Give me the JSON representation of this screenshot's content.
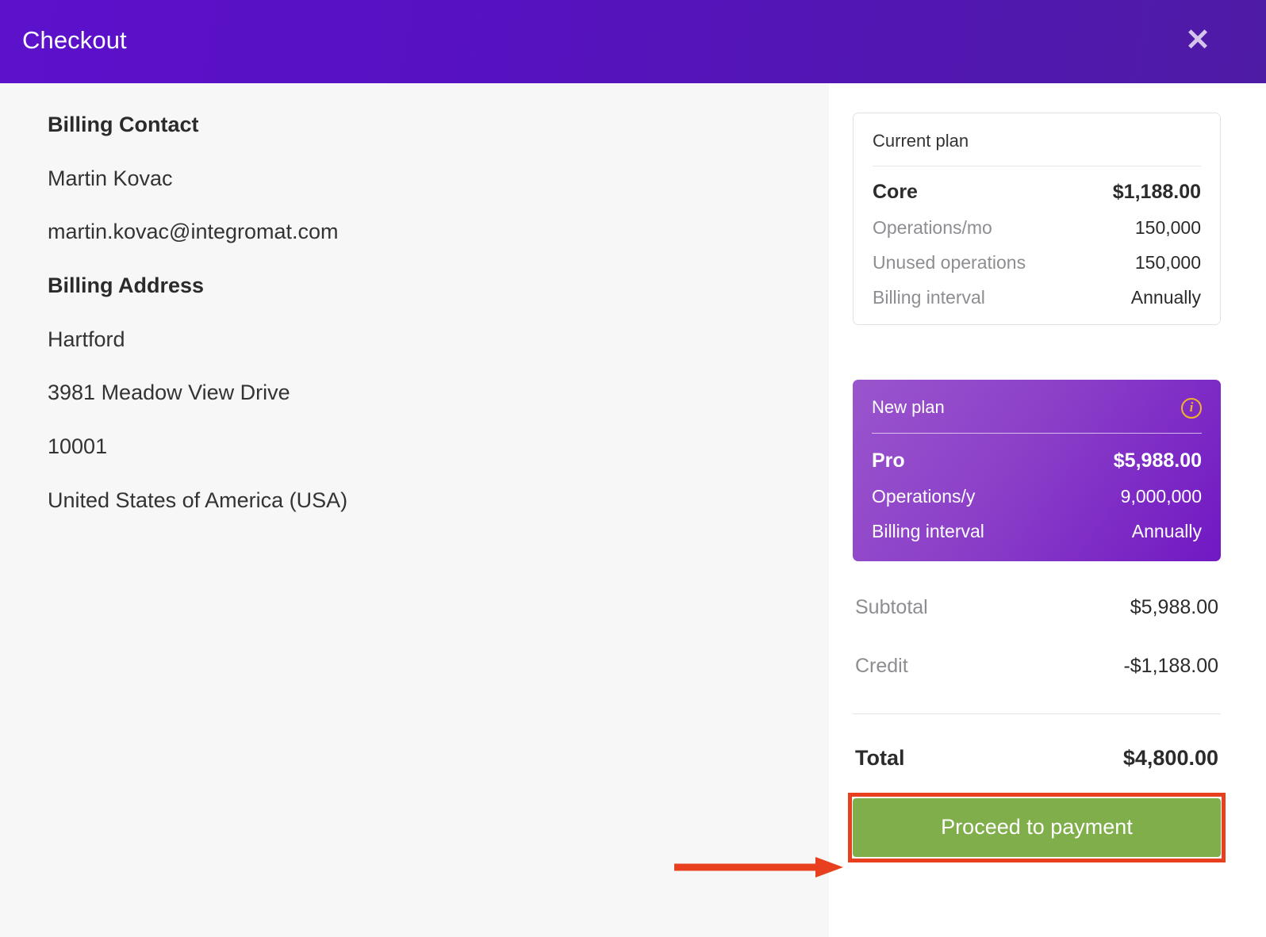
{
  "header": {
    "title": "Checkout",
    "close_label": "✕",
    "close_icon": "close-icon"
  },
  "billing": {
    "contact_heading": "Billing Contact",
    "contact_name": "Martin Kovac",
    "contact_email": "martin.kovac@integromat.com",
    "address_heading": "Billing Address",
    "address_lines": [
      "Hartford",
      "3981 Meadow View Drive",
      "10001",
      "United States of America (USA)"
    ]
  },
  "current_plan": {
    "caption": "Current plan",
    "name": "Core",
    "price": "$1,188.00",
    "rows": [
      {
        "label": "Operations/mo",
        "value": "150,000"
      },
      {
        "label": "Unused operations",
        "value": "150,000"
      },
      {
        "label": "Billing interval",
        "value": "Annually"
      }
    ]
  },
  "new_plan": {
    "caption": "New plan",
    "info_icon": "info-icon",
    "name": "Pro",
    "price": "$5,988.00",
    "rows": [
      {
        "label": "Operations/y",
        "value": "9,000,000"
      },
      {
        "label": "Billing interval",
        "value": "Annually"
      }
    ]
  },
  "summary": {
    "subtotal_label": "Subtotal",
    "subtotal_value": "$5,988.00",
    "credit_label": "Credit",
    "credit_value": "-$1,188.00",
    "total_label": "Total",
    "total_value": "$4,800.00"
  },
  "cta": {
    "label": "Proceed to payment"
  },
  "colors": {
    "header_gradient_start": "#5c11cb",
    "header_gradient_end": "#4e1ba5",
    "new_plan_gradient_start": "#9a55cd",
    "new_plan_gradient_end": "#7118c3",
    "cta_green": "#7fae4b",
    "annotation_red": "#e8401f",
    "info_icon_gold": "#f0b429",
    "left_pane_bg": "#f7f7f7"
  }
}
